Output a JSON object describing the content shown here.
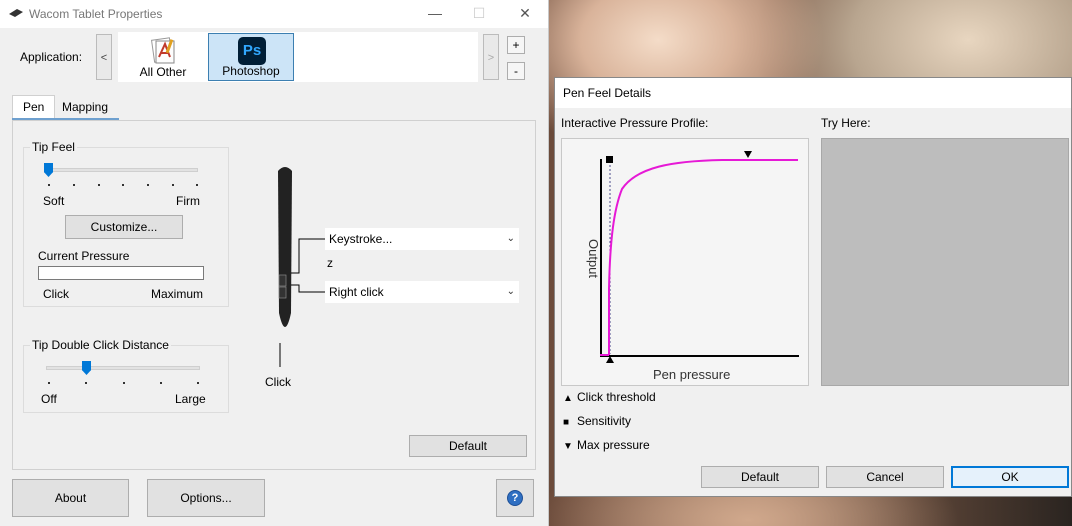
{
  "main": {
    "title": "Wacom Tablet Properties",
    "application_label": "Application:",
    "prev": "<",
    "next": ">",
    "add": "+",
    "remove": "-",
    "apps": [
      {
        "label": "All Other",
        "selected": false
      },
      {
        "label": "Photoshop",
        "selected": true,
        "icon_text": "Ps"
      }
    ],
    "tabs": [
      {
        "label": "Pen",
        "active": true
      },
      {
        "label": "Mapping",
        "active": false
      }
    ],
    "tip_feel": {
      "title": "Tip Feel",
      "min_label": "Soft",
      "max_label": "Firm",
      "level_fraction": 0.0,
      "customize": "Customize...",
      "current_pressure": "Current Pressure",
      "pressure_fraction": 0.0,
      "click_label": "Click",
      "maximum_label": "Maximum"
    },
    "tip_double_click": {
      "title": "Tip Double Click Distance",
      "min_label": "Off",
      "max_label": "Large",
      "level_fraction": 0.25
    },
    "pen_buttons": {
      "upper": "Keystroke...",
      "upper_value": "z",
      "lower": "Right click",
      "tip": "Click"
    },
    "default": "Default",
    "about": "About",
    "options": "Options...",
    "help": "?"
  },
  "dialog": {
    "title": "Pen Feel Details",
    "profile_label": "Interactive Pressure Profile:",
    "try_label": "Try Here:",
    "y_axis": "Output",
    "x_axis": "Pen pressure",
    "legend": [
      {
        "symbol": "▲",
        "text": "Click threshold"
      },
      {
        "symbol": "■",
        "text": "Sensitivity"
      },
      {
        "symbol": "▼",
        "text": "Max pressure"
      }
    ],
    "default": "Default",
    "cancel": "Cancel",
    "ok": "OK",
    "curve_color": "#e619d6"
  }
}
